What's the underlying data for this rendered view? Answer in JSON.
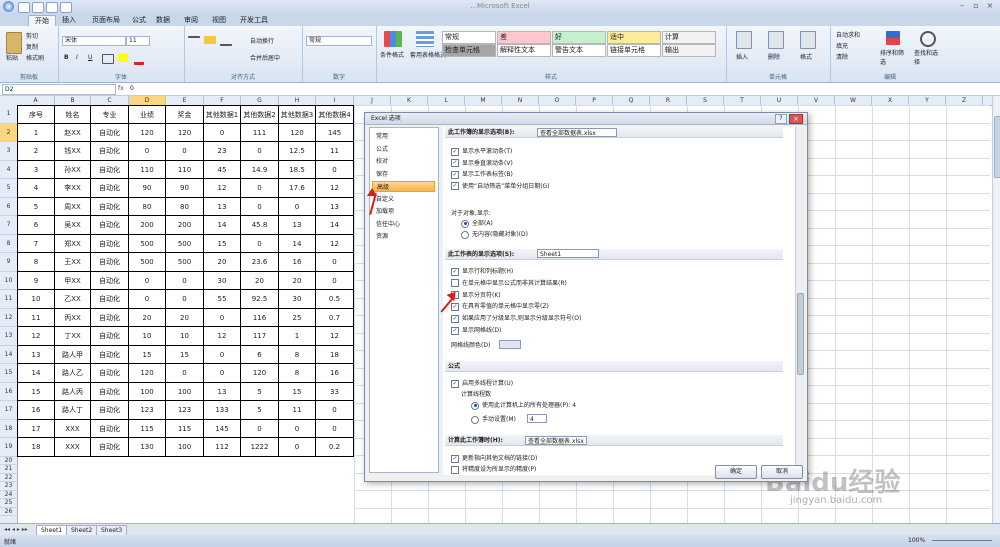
{
  "window": {
    "title": "...Microsoft Excel"
  },
  "ribbon": {
    "tabs": [
      "开始",
      "插入",
      "页面布局",
      "公式",
      "数据",
      "审阅",
      "视图",
      "开发工具"
    ],
    "active_tab": "开始",
    "clipboard": {
      "paste": "粘贴",
      "cut": "剪切",
      "copy": "复制",
      "format_painter": "格式刷",
      "label": "剪贴板"
    },
    "font": {
      "name": "宋体",
      "size": "11",
      "label": "字体",
      "bold": "B",
      "italic": "I",
      "underline": "U"
    },
    "alignment": {
      "wrap": "自动换行",
      "merge": "合并后居中",
      "label": "对齐方式"
    },
    "number": {
      "format": "常规",
      "label": "数字"
    },
    "styles": {
      "conditional": "条件格式",
      "table": "套用表格格式",
      "label": "样式",
      "cells": [
        {
          "t": "常规",
          "bg": "#ffffff"
        },
        {
          "t": "差",
          "bg": "#ffc7ce"
        },
        {
          "t": "好",
          "bg": "#c6efce"
        },
        {
          "t": "适中",
          "bg": "#ffeb9c"
        },
        {
          "t": "计算",
          "bg": "#f2f2f2"
        },
        {
          "t": "检查单元格",
          "bg": "#a5a5a5"
        },
        {
          "t": "解释性文本",
          "bg": "#ffffff"
        },
        {
          "t": "警告文本",
          "bg": "#ffffff"
        },
        {
          "t": "链接单元格",
          "bg": "#ffffff"
        },
        {
          "t": "输出",
          "bg": "#f2f2f2"
        }
      ]
    },
    "cells_grp": {
      "insert": "插入",
      "delete": "删除",
      "format": "格式",
      "label": "单元格"
    },
    "editing": {
      "autosum": "自动求和",
      "fill": "填充",
      "clear": "清除",
      "sort": "排序和筛选",
      "find": "查找和选择",
      "label": "编辑"
    }
  },
  "formula_bar": {
    "name_box": "D2",
    "fx": "fx",
    "value": "0"
  },
  "columns": [
    "A",
    "B",
    "C",
    "D",
    "E",
    "F",
    "G",
    "H",
    "I",
    "J",
    "K",
    "L",
    "M",
    "N",
    "O",
    "P",
    "Q",
    "R",
    "S",
    "T",
    "U",
    "V",
    "W",
    "X",
    "Y",
    "Z"
  ],
  "table": {
    "header": [
      "序号",
      "姓名",
      "专业",
      "业绩",
      "奖金",
      "其他数据1",
      "其他数据2",
      "其他数据3",
      "其他数据4"
    ],
    "rows": [
      [
        "1",
        "赵XX",
        "自动化",
        "120",
        "120",
        "0",
        "111",
        "120",
        "145"
      ],
      [
        "2",
        "钱XX",
        "自动化",
        "0",
        "0",
        "23",
        "0",
        "12.5",
        "11"
      ],
      [
        "3",
        "孙XX",
        "自动化",
        "110",
        "110",
        "45",
        "14.9",
        "18.5",
        "0"
      ],
      [
        "4",
        "李XX",
        "自动化",
        "90",
        "90",
        "12",
        "0",
        "17.6",
        "12"
      ],
      [
        "5",
        "周XX",
        "自动化",
        "80",
        "80",
        "13",
        "0",
        "0",
        "13"
      ],
      [
        "6",
        "吴XX",
        "自动化",
        "200",
        "200",
        "14",
        "45.8",
        "13",
        "14"
      ],
      [
        "7",
        "郑XX",
        "自动化",
        "500",
        "500",
        "15",
        "0",
        "14",
        "12"
      ],
      [
        "8",
        "王XX",
        "自动化",
        "500",
        "500",
        "20",
        "23.6",
        "16",
        "0"
      ],
      [
        "9",
        "甲XX",
        "自动化",
        "0",
        "0",
        "30",
        "20",
        "20",
        "0"
      ],
      [
        "10",
        "乙XX",
        "自动化",
        "0",
        "0",
        "55",
        "92.5",
        "30",
        "0.5"
      ],
      [
        "11",
        "丙XX",
        "自动化",
        "20",
        "20",
        "0",
        "116",
        "25",
        "0.7"
      ],
      [
        "12",
        "丁XX",
        "自动化",
        "10",
        "10",
        "12",
        "117",
        "1",
        "12"
      ],
      [
        "13",
        "路人甲",
        "自动化",
        "15",
        "15",
        "0",
        "6",
        "8",
        "18"
      ],
      [
        "14",
        "路人乙",
        "自动化",
        "120",
        "0",
        "0",
        "120",
        "8",
        "16"
      ],
      [
        "15",
        "路人丙",
        "自动化",
        "100",
        "100",
        "13",
        "5",
        "15",
        "33"
      ],
      [
        "16",
        "路人丁",
        "自动化",
        "123",
        "123",
        "133",
        "5",
        "11",
        "0"
      ],
      [
        "17",
        "XXX",
        "自动化",
        "115",
        "115",
        "145",
        "0",
        "0",
        "0"
      ],
      [
        "18",
        "XXX",
        "自动化",
        "130",
        "100",
        "112",
        "1222",
        "0",
        "0.2"
      ]
    ],
    "empty_rows": [
      "20",
      "21",
      "22",
      "23",
      "24",
      "25",
      "26"
    ]
  },
  "sheets": [
    "Sheet1",
    "Sheet2",
    "Sheet3"
  ],
  "status": {
    "left": "就绪",
    "zoom": "100%"
  },
  "dialog": {
    "title": "Excel 选项",
    "nav": [
      "常用",
      "公式",
      "校对",
      "保存",
      "高级",
      "自定义",
      "加载项",
      "信任中心",
      "资源"
    ],
    "selected_nav": "高级",
    "s1_header": "此工作簿的显示选项(B):",
    "s1_book": "查看全部数据表.xlsx",
    "s1_opts": [
      "显示水平滚动条(T)",
      "显示垂直滚动条(V)",
      "显示工作表标签(B)",
      "使用“自动筛选”菜单分组日期(G)"
    ],
    "objects_label": "对于对象,显示:",
    "objects_opts": [
      "全部(A)",
      "无内容(隐藏对象)(D)"
    ],
    "s2_header": "此工作表的显示选项(S):",
    "s2_sheet": "Sheet1",
    "s2_opts": [
      "显示行和列标题(H)",
      "在单元格中显示公式而非其计算结果(R)",
      "显示分页符(K)",
      "在具有零值的单元格中显示零(Z)",
      "如果应用了分级显示,则显示分级显示符号(O)",
      "显示网格线(D)"
    ],
    "gridcolor_label": "网格线颜色(D)",
    "s3_header": "公式",
    "s3_multi": "启用多线程计算(U)",
    "threads_label": "计算线程数",
    "threads_opts": [
      "使用此计算机上的所有处理器(P):",
      "手动设置(M)"
    ],
    "threads_all": "4",
    "threads_manual": "4",
    "s4_header": "计算此工作簿时(H):",
    "s4_book": "查看全部数据表.xlsx",
    "s4_opts": [
      "更新指向其他文档的链接(D)",
      "将精度设为所显示的精度(P)"
    ],
    "ok": "确定",
    "cancel": "取消"
  },
  "watermark": {
    "text": "Baidu经验",
    "url": "jingyan.baidu.com"
  }
}
